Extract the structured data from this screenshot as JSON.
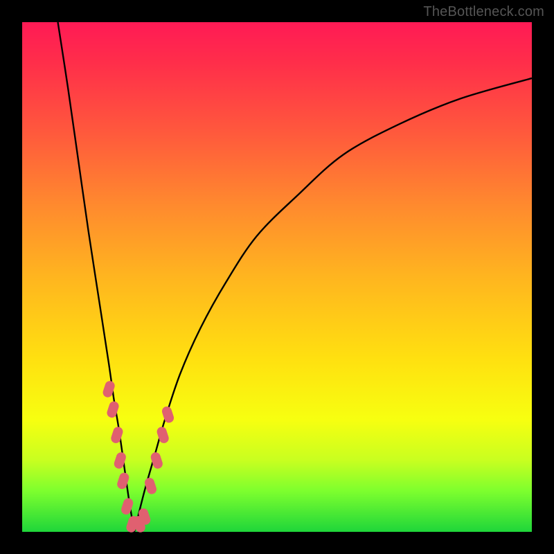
{
  "watermark": "TheBottleneck.com",
  "colors": {
    "page_bg": "#000000",
    "curve_stroke": "#000000",
    "marker_fill": "#e06070",
    "gradient_stops": [
      "#ff1a55",
      "#ff2e4a",
      "#ff5a3c",
      "#ff8a2e",
      "#ffb51f",
      "#ffe010",
      "#f7ff10",
      "#c8ff20",
      "#7dff2e",
      "#1fd63a"
    ]
  },
  "chart_data": {
    "type": "line",
    "title": "",
    "xlabel": "",
    "ylabel": "",
    "xlim": [
      0,
      100
    ],
    "ylim": [
      0,
      100
    ],
    "grid": false,
    "legend": "none",
    "note": "Two black curves forming a V/valley shape. Left branch descends steeply from the top-left corner; right branch rises with diminishing slope toward the upper-right. The valley bottom sits at about x≈22, y≈0. Pink lozenge markers cluster along both branches near the valley.",
    "series": [
      {
        "name": "left-branch",
        "x": [
          7,
          9,
          11,
          13,
          15,
          17,
          18,
          19,
          20,
          21,
          22
        ],
        "y": [
          100,
          87,
          73,
          59,
          46,
          33,
          26,
          20,
          13,
          6,
          0
        ]
      },
      {
        "name": "right-branch",
        "x": [
          22,
          24,
          26,
          28,
          31,
          35,
          40,
          46,
          54,
          63,
          74,
          86,
          100
        ],
        "y": [
          0,
          8,
          15,
          22,
          31,
          40,
          49,
          58,
          66,
          74,
          80,
          85,
          89
        ]
      }
    ],
    "markers": [
      {
        "x": 17.0,
        "y": 28
      },
      {
        "x": 17.8,
        "y": 24
      },
      {
        "x": 18.6,
        "y": 19
      },
      {
        "x": 19.2,
        "y": 14
      },
      {
        "x": 19.8,
        "y": 10
      },
      {
        "x": 20.6,
        "y": 5
      },
      {
        "x": 21.6,
        "y": 1.5
      },
      {
        "x": 23.0,
        "y": 1.5
      },
      {
        "x": 24.0,
        "y": 3
      },
      {
        "x": 25.2,
        "y": 9
      },
      {
        "x": 26.4,
        "y": 14
      },
      {
        "x": 27.6,
        "y": 19
      },
      {
        "x": 28.6,
        "y": 23
      }
    ]
  }
}
